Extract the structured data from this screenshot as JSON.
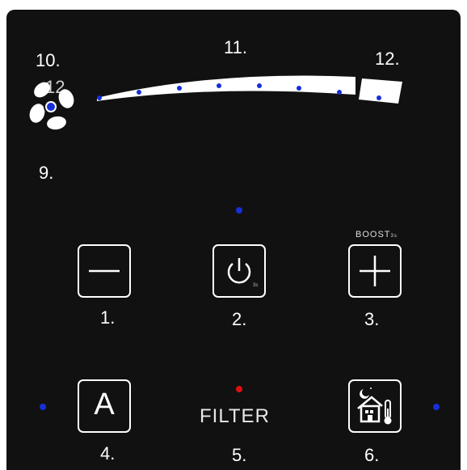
{
  "labels": {
    "l10": "10.",
    "l11": "11.",
    "l12": "12.",
    "l12_fan": "12.",
    "l9": "9.",
    "l1": "1.",
    "l2": "2.",
    "l3": "3.",
    "l4": "4.",
    "l5": "5.",
    "l6": "6."
  },
  "boost": {
    "label": "BOOST",
    "sub": "3s"
  },
  "power": {
    "sub": "3s"
  },
  "auto_button": {
    "glyph": "A"
  },
  "filter": {
    "label": "FILTER"
  },
  "colors": {
    "panel": "#111111",
    "indicator_blue": "#1530d8",
    "filter_indicator_red": "#e01010",
    "foreground": "#ffffff"
  },
  "icons": {
    "fan": "fan-icon",
    "minus": "minus-icon",
    "power": "power-icon",
    "plus": "plus-icon",
    "night_house": "night-house-thermometer-icon"
  }
}
